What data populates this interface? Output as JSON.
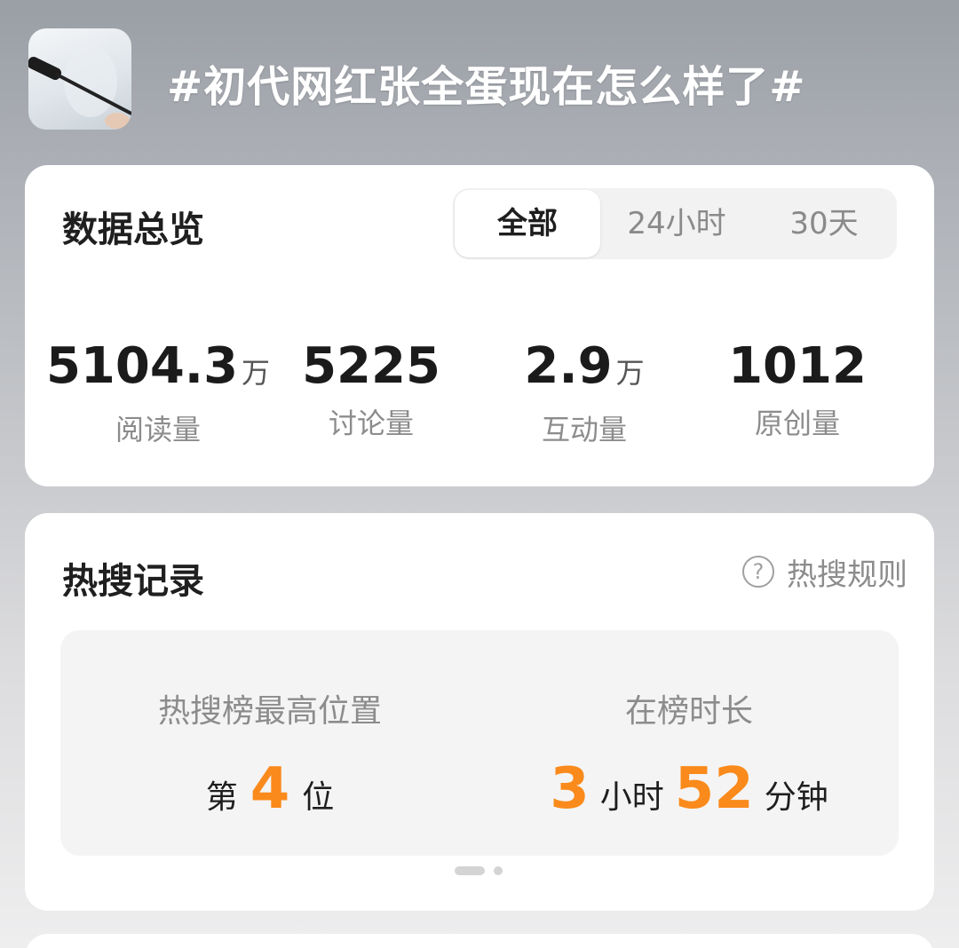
{
  "header": {
    "title": "#初代网红张全蛋现在怎么样了#",
    "avatar_icon": "microphone-icon"
  },
  "overview": {
    "title": "数据总览",
    "tabs": [
      {
        "label": "全部",
        "active": true
      },
      {
        "label": "24小时",
        "active": false
      },
      {
        "label": "30天",
        "active": false
      }
    ],
    "stats": [
      {
        "value": "5104.3",
        "unit": "万",
        "label": "阅读量"
      },
      {
        "value": "5225",
        "unit": "",
        "label": "讨论量"
      },
      {
        "value": "2.9",
        "unit": "万",
        "label": "互动量"
      },
      {
        "value": "1012",
        "unit": "",
        "label": "原创量"
      }
    ]
  },
  "hot_search": {
    "title": "热搜记录",
    "rules_label": "热搜规则",
    "rules_icon": "question-circle-icon",
    "peak": {
      "title": "热搜榜最高位置",
      "prefix": "第",
      "value": "4",
      "suffix": "位"
    },
    "duration": {
      "title": "在榜时长",
      "hours": "3",
      "hours_unit": "小时",
      "minutes": "52",
      "minutes_unit": "分钟"
    },
    "pager": {
      "pages": 2,
      "current": 1
    }
  },
  "colors": {
    "accent": "#fa8a1b",
    "card": "#ffffff",
    "muted_text": "#8c8c8c"
  }
}
